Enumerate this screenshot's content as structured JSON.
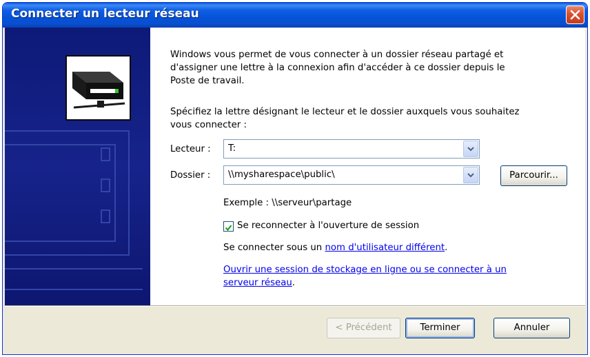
{
  "window": {
    "title": "Connecter un lecteur réseau"
  },
  "intro": {
    "line1": "Windows vous permet de vous connecter à un dossier réseau partagé et",
    "line2": "d'assigner une lettre à la connexion afin d'accéder à ce dossier depuis le",
    "line3": "Poste de travail."
  },
  "instruction": {
    "line1": "Spécifiez la lettre désignant le lecteur et le dossier auxquels vous souhaitez",
    "line2": "vous connecter :"
  },
  "form": {
    "drive_label": "Lecteur :",
    "drive_value": "T:",
    "folder_label": "Dossier :",
    "folder_value": "\\\\mysharespace\\public\\",
    "browse_label": "Parcourir...",
    "example_text": "Exemple : \\\\serveur\\partage",
    "reconnect_label": "Se reconnecter à l'ouverture de session",
    "reconnect_checked": true,
    "connect_as_prefix": "Se connecter sous un ",
    "connect_as_link": "nom d'utilisateur différent",
    "connect_as_suffix": ".",
    "online_link_line1": "Ouvrir une session de stockage en ligne ou se connecter à un",
    "online_link_line2": "serveur réseau",
    "online_link_suffix": "."
  },
  "buttons": {
    "back": "< Précédent",
    "finish": "Terminer",
    "cancel": "Annuler"
  },
  "colors": {
    "titlebar": "#0553d8",
    "sidebar": "#16238a",
    "link": "#0000ee",
    "dialog_bg": "#ece9d8"
  }
}
